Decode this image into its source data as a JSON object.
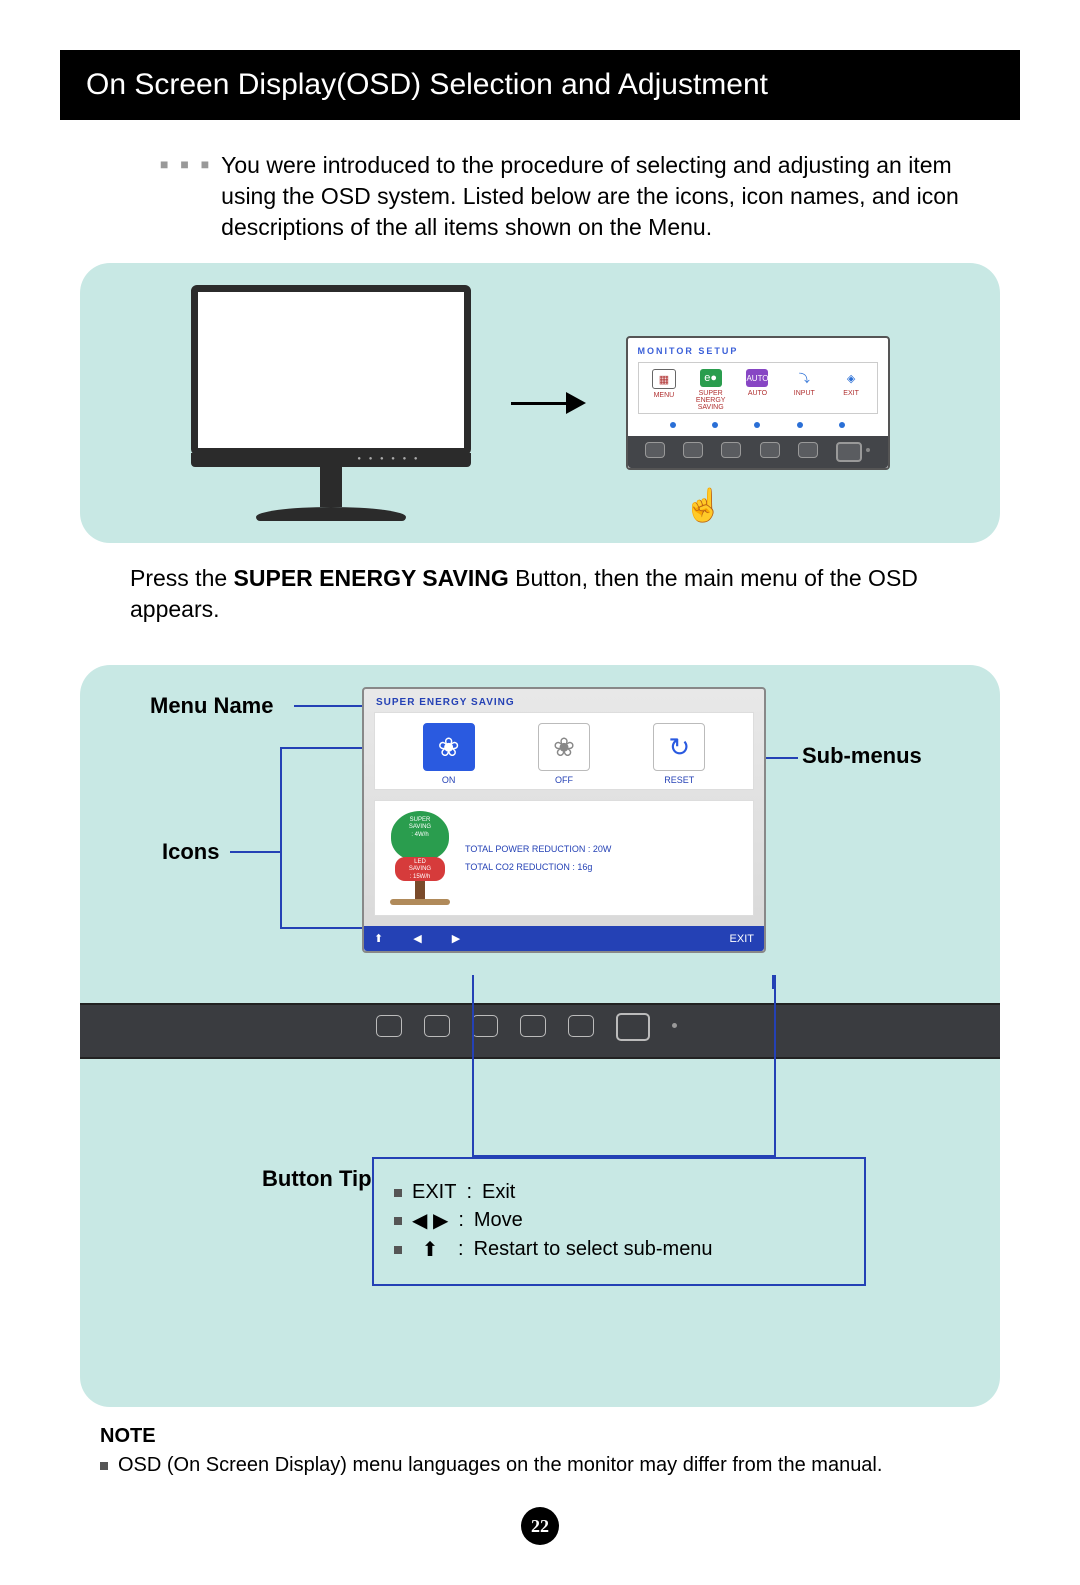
{
  "title": "On Screen Display(OSD) Selection and Adjustment",
  "intro": "You were introduced to the procedure of selecting and adjusting an item using the OSD system. Listed below are the icons, icon names, and icon descriptions of the all items shown on the Menu.",
  "popup": {
    "title": "MONITOR SETUP",
    "items": [
      "MENU",
      "SUPER ENERGY SAVING",
      "AUTO",
      "INPUT",
      "EXIT"
    ]
  },
  "press_text_pre": "Press the ",
  "press_text_bold": "SUPER ENERGY SAVING",
  "press_text_post": " Button, then the main menu of the OSD appears.",
  "labels": {
    "menu_name": "Menu Name",
    "sub_menus": "Sub-menus",
    "icons": "Icons",
    "button_tip": "Button Tip"
  },
  "osd_menu": {
    "title": "SUPER ENERGY SAVING",
    "on": "ON",
    "off": "OFF",
    "reset": "RESET",
    "tree_top_l1": "SUPER",
    "tree_top_l2": "SAVING",
    "tree_top_l3": ": 4W/h",
    "tree_mid_l1": "LED",
    "tree_mid_l2": "SAVING",
    "tree_mid_l3": ": 15W/h",
    "stat1": "TOTAL POWER REDUCTION : 20W",
    "stat2": "TOTAL CO2 REDUCTION : 16g",
    "nav_up": "⬆",
    "nav_left": "◀",
    "nav_right": "▶",
    "nav_exit": "EXIT"
  },
  "tips": {
    "exit_key": "EXIT",
    "exit_desc": "Exit",
    "move_desc": "Move",
    "restart_desc": "Restart to select sub-menu"
  },
  "note_head": "NOTE",
  "note_text": "OSD (On Screen Display) menu languages on the monitor may differ from the manual.",
  "page_number": "22"
}
